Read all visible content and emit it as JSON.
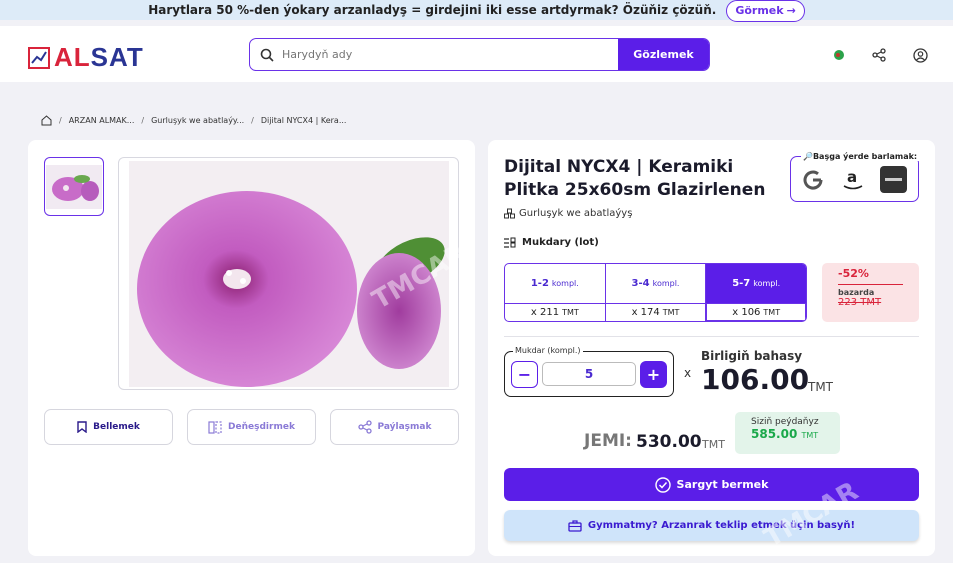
{
  "banner": {
    "text": "Harytlara 50 %-den ýokary arzanladyş = girdejini iki esse artdyrmak? Özüňiz çözüň.",
    "cta": "Görmek"
  },
  "header": {
    "logo_part1": "AL",
    "logo_part2": "SAT",
    "search_placeholder": "Harydyň ady",
    "search_button": "Gözlemek",
    "colors": {
      "brand_red": "#d9243b",
      "brand_blue": "#2a3594",
      "accent": "#5b1ee8"
    }
  },
  "breadcrumb": {
    "items": [
      "ARZAN ALMAK...",
      "Gurluşyk we abatlaýy...",
      "Dijital NYCX4 | Kera..."
    ]
  },
  "gallery": {
    "actions": [
      "Bellemek",
      "Deňeşdirmek",
      "Paýlaşmak"
    ],
    "watermark": "TMCAR"
  },
  "product": {
    "title": "Dijital NYCX4 | Keramiki Plitka 25x60sm Glazirlenen",
    "category": "Gurluşyk we abatlaýyş",
    "search_elsewhere_label": "🔎Başga ýerde barlamak:",
    "search_engines": [
      "google-icon",
      "amazon-icon",
      "tmcars-icon"
    ],
    "quantity_label": "Mukdary (lot)",
    "tiers": [
      {
        "range": "1-2",
        "unit": "kompl.",
        "price": "x 211",
        "currency": "TMT"
      },
      {
        "range": "3-4",
        "unit": "kompl.",
        "price": "x 174",
        "currency": "TMT"
      },
      {
        "range": "5-7",
        "unit": "kompl.",
        "price": "x 106",
        "currency": "TMT"
      }
    ],
    "active_tier": 2,
    "discount": {
      "percent": "-52%",
      "label": "bazarda",
      "old_price": "223 TMT"
    },
    "quantity_field_label": "Mukdar (kompl.)",
    "quantity_value": "5",
    "x": "x",
    "unit_price_label": "Birligiň bahasy",
    "unit_price": "106.00",
    "currency": "TMT",
    "total_label": "JEMI:",
    "total_value": "530.00",
    "savings_label": "Siziň peýdaňyz",
    "savings_value": "585.00",
    "order_button": "Sargyt bermek",
    "offer_button": "Gymmatmy? Arzanrak teklip etmek üçin basyň!"
  }
}
